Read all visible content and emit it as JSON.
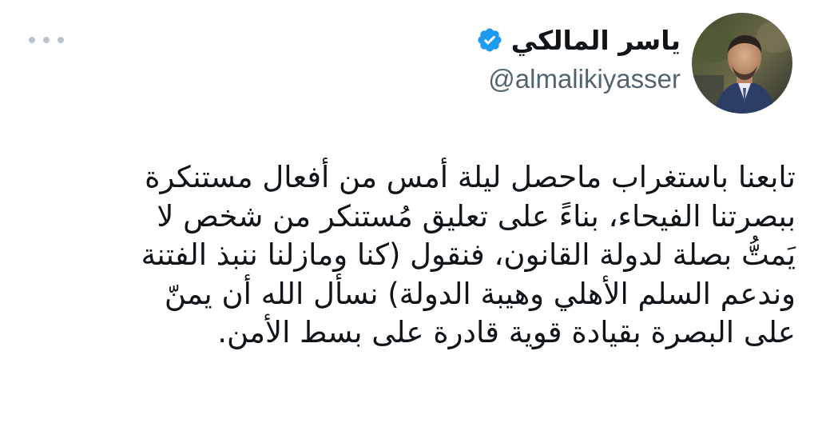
{
  "author": {
    "display_name": "ياسر المالكي",
    "handle": "@almalikiyasser",
    "verified_icon": "verified-badge-icon",
    "avatar_icon": "profile-photo",
    "accent_color": "#1d9bf0"
  },
  "menu": {
    "icon": "more-options-icon"
  },
  "tweet": {
    "lines": [
      "تابعنا باستغراب ماحصل ليلة أمس من أفعال مستنكرة",
      "ببصرتنا الفيحاء، بناءً على تعليق مُستنكر من شخص لا",
      "يَمتُّ بصلة لدولة القانون، فنقول (كنا ومازلنا ننبذ الفتنة",
      "وندعم السلم الأهلي وهيبة الدولة) نسأل الله أن يمنّ",
      "على البصرة بقيادة قوية قادرة على بسط الأمن."
    ]
  }
}
